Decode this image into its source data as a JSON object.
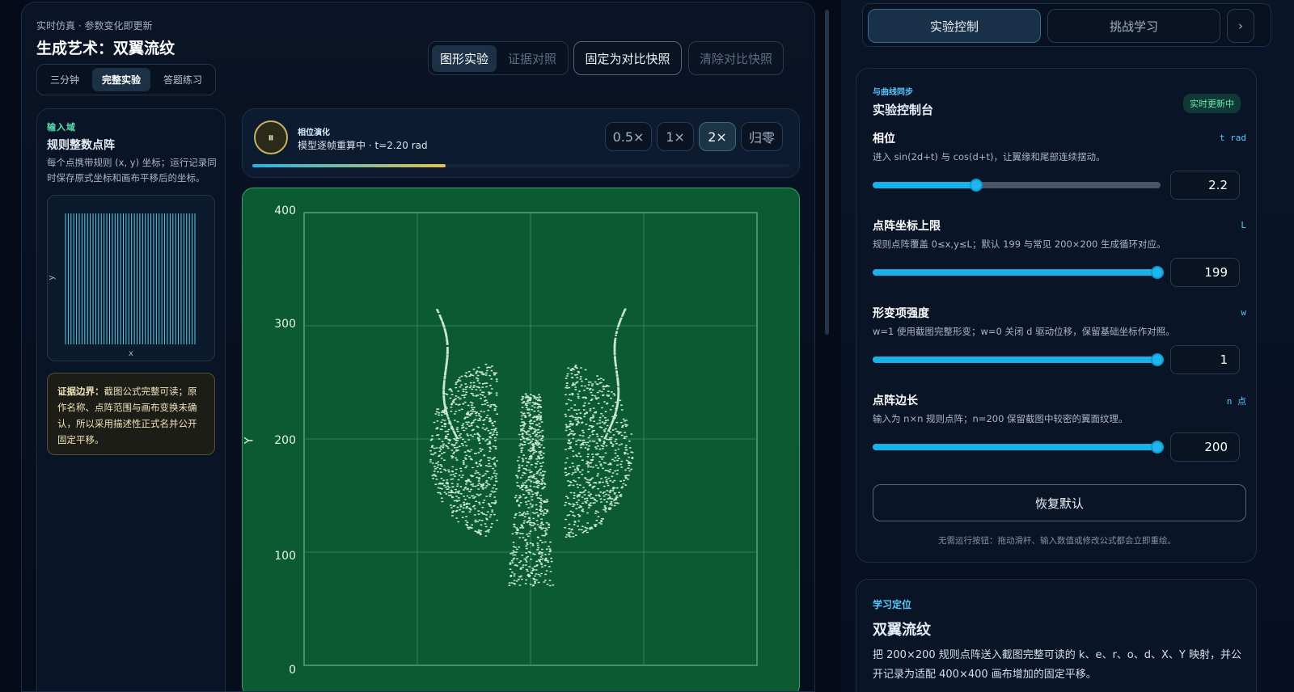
{
  "header": {
    "kicker": "实时仿真 · 参数变化即更新",
    "title": "生成艺术：双翼流纹",
    "modes": [
      "三分钟",
      "完整实验",
      "答题练习"
    ],
    "view_tabs": [
      "图形实验",
      "证据对照"
    ],
    "snapshot_label": "固定为对比快照",
    "clear_snapshot_label": "清除对比快照"
  },
  "input_domain": {
    "kicker": "输入域",
    "title": "规则整数点阵",
    "desc": "每个点携带规则 (x, y) 坐标；运行记录同时保存原式坐标和画布平移后的坐标。",
    "axis_x": "x",
    "axis_y": "y",
    "note_strong": "证据边界：",
    "note": "截图公式完整可读；原作名称、点阵范围与画布变换未确认，所以采用描述性正式名并公开固定平移。"
  },
  "player": {
    "pause_icon": "⏸",
    "kicker": "相位演化",
    "status": "模型逐帧重算中 · t=2.20 rad",
    "progress": 0.36,
    "speeds": [
      "0.5×",
      "1×",
      "2×",
      "归零"
    ]
  },
  "plot": {
    "y_ticks": [
      "400",
      "300",
      "200",
      "100",
      "0"
    ],
    "y_label": "Y",
    "colors": {
      "bg": "#0b5a32",
      "points": "#e8fff2"
    }
  },
  "right_tabs": [
    "实验控制",
    "挑战学习"
  ],
  "right_next": "›",
  "control": {
    "kicker": "与曲线同步",
    "title": "实验控制台",
    "badge": "实时更新中",
    "items": [
      {
        "label": "相位",
        "unit": "t rad",
        "desc": "进入 sin(2d+t) 与 cos(d+t)，让翼缘和尾部连续摆动。",
        "value": "2.2",
        "fraction": 0.36
      },
      {
        "label": "点阵坐标上限",
        "unit": "L",
        "desc": "规则点阵覆盖 0≤x,y≤L；默认 199 与常见 200×200 生成循环对应。",
        "value": "199",
        "fraction": 0.99
      },
      {
        "label": "形变项强度",
        "unit": "w",
        "desc": "w=1 使用截图完整形变；w=0 关闭 d 驱动位移，保留基础坐标作对照。",
        "value": "1",
        "fraction": 0.99
      },
      {
        "label": "点阵边长",
        "unit": "n 点",
        "desc": "输入为 n×n 规则点阵；n=200 保留截图中较密的翼面纹理。",
        "value": "200",
        "fraction": 0.99
      }
    ],
    "reset_label": "恢复默认",
    "hint": "无需运行按钮：拖动滑杆、输入数值或修改公式都会立即重绘。"
  },
  "learn": {
    "kicker": "学习定位",
    "title": "双翼流纹",
    "desc": "把 200×200 规则点阵送入截图完整可读的 k、e、r、o、d、X、Y 映射，并公开记录为适配 400×400 画布增加的固定平移。"
  }
}
